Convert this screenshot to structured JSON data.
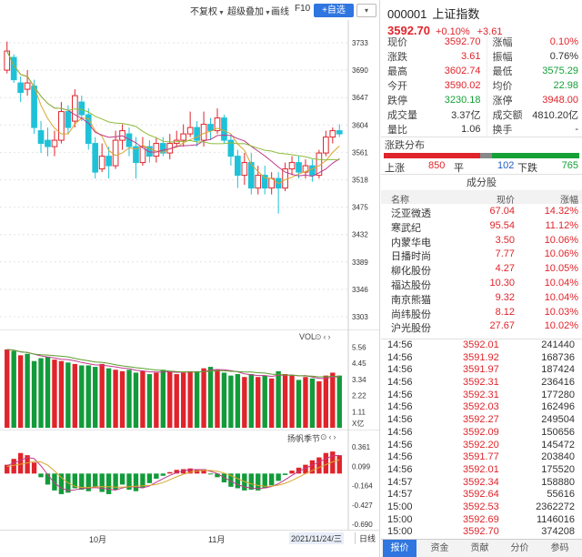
{
  "toolbar": {
    "adjust": "不复权",
    "overlay": "超级叠加",
    "drawline": "画线",
    "f10": "F10",
    "watch": "+自选"
  },
  "main_chart": {
    "price_ticks": [
      "3733",
      "3690",
      "3647",
      "3604",
      "3561",
      "3518",
      "3475",
      "3432",
      "3389",
      "3346",
      "3303"
    ],
    "ylim": [
      3303,
      3733
    ],
    "candles": [
      {
        "o": 3690,
        "c": 3720,
        "h": 3735,
        "l": 3685
      },
      {
        "o": 3710,
        "c": 3675,
        "h": 3715,
        "l": 3670
      },
      {
        "o": 3670,
        "c": 3655,
        "h": 3680,
        "l": 3640
      },
      {
        "o": 3660,
        "c": 3670,
        "h": 3690,
        "l": 3650
      },
      {
        "o": 3665,
        "c": 3600,
        "h": 3675,
        "l": 3590
      },
      {
        "o": 3595,
        "c": 3575,
        "h": 3610,
        "l": 3560
      },
      {
        "o": 3580,
        "c": 3570,
        "h": 3600,
        "l": 3555
      },
      {
        "o": 3570,
        "c": 3580,
        "h": 3595,
        "l": 3555
      },
      {
        "o": 3580,
        "c": 3625,
        "h": 3640,
        "l": 3575
      },
      {
        "o": 3625,
        "c": 3600,
        "h": 3635,
        "l": 3590
      },
      {
        "o": 3610,
        "c": 3650,
        "h": 3660,
        "l": 3600
      },
      {
        "o": 3640,
        "c": 3620,
        "h": 3650,
        "l": 3610
      },
      {
        "o": 3620,
        "c": 3575,
        "h": 3630,
        "l": 3565
      },
      {
        "o": 3575,
        "c": 3530,
        "h": 3585,
        "l": 3520
      },
      {
        "o": 3535,
        "c": 3555,
        "h": 3575,
        "l": 3530
      },
      {
        "o": 3555,
        "c": 3540,
        "h": 3570,
        "l": 3520
      },
      {
        "o": 3540,
        "c": 3580,
        "h": 3595,
        "l": 3535
      },
      {
        "o": 3580,
        "c": 3595,
        "h": 3605,
        "l": 3565
      },
      {
        "o": 3590,
        "c": 3570,
        "h": 3600,
        "l": 3555
      },
      {
        "o": 3570,
        "c": 3545,
        "h": 3585,
        "l": 3520
      },
      {
        "o": 3545,
        "c": 3570,
        "h": 3585,
        "l": 3540
      },
      {
        "o": 3570,
        "c": 3555,
        "h": 3580,
        "l": 3545
      },
      {
        "o": 3555,
        "c": 3575,
        "h": 3585,
        "l": 3545
      },
      {
        "o": 3575,
        "c": 3560,
        "h": 3585,
        "l": 3555
      },
      {
        "o": 3560,
        "c": 3575,
        "h": 3590,
        "l": 3550
      },
      {
        "o": 3575,
        "c": 3580,
        "h": 3595,
        "l": 3570
      },
      {
        "o": 3580,
        "c": 3590,
        "h": 3605,
        "l": 3570
      },
      {
        "o": 3590,
        "c": 3600,
        "h": 3625,
        "l": 3585
      },
      {
        "o": 3600,
        "c": 3580,
        "h": 3610,
        "l": 3570
      },
      {
        "o": 3580,
        "c": 3605,
        "h": 3625,
        "l": 3570
      },
      {
        "o": 3605,
        "c": 3595,
        "h": 3615,
        "l": 3580
      },
      {
        "o": 3595,
        "c": 3615,
        "h": 3630,
        "l": 3590
      },
      {
        "o": 3615,
        "c": 3580,
        "h": 3620,
        "l": 3575
      },
      {
        "o": 3580,
        "c": 3555,
        "h": 3590,
        "l": 3540
      },
      {
        "o": 3555,
        "c": 3525,
        "h": 3565,
        "l": 3505
      },
      {
        "o": 3525,
        "c": 3545,
        "h": 3560,
        "l": 3510
      },
      {
        "o": 3545,
        "c": 3505,
        "h": 3560,
        "l": 3495
      },
      {
        "o": 3505,
        "c": 3525,
        "h": 3540,
        "l": 3495
      },
      {
        "o": 3525,
        "c": 3505,
        "h": 3540,
        "l": 3495
      },
      {
        "o": 3505,
        "c": 3520,
        "h": 3530,
        "l": 3495
      },
      {
        "o": 3520,
        "c": 3505,
        "h": 3530,
        "l": 3465
      },
      {
        "o": 3505,
        "c": 3535,
        "h": 3545,
        "l": 3500
      },
      {
        "o": 3535,
        "c": 3545,
        "h": 3555,
        "l": 3525
      },
      {
        "o": 3545,
        "c": 3530,
        "h": 3555,
        "l": 3520
      },
      {
        "o": 3530,
        "c": 3540,
        "h": 3550,
        "l": 3520
      },
      {
        "o": 3540,
        "c": 3525,
        "h": 3550,
        "l": 3515
      },
      {
        "o": 3525,
        "c": 3560,
        "h": 3565,
        "l": 3520
      },
      {
        "o": 3560,
        "c": 3585,
        "h": 3595,
        "l": 3555
      },
      {
        "o": 3585,
        "c": 3595,
        "h": 3600,
        "l": 3575
      },
      {
        "o": 3595,
        "c": 3590,
        "h": 3605,
        "l": 3585
      }
    ]
  },
  "vol_chart": {
    "title": "VOL",
    "ticks": [
      "5.56",
      "4.45",
      "3.34",
      "2.22",
      "1.11"
    ],
    "unit": "X亿",
    "ylim": [
      0,
      5.9
    ],
    "values": [
      5.4,
      5.3,
      5.0,
      5.1,
      4.6,
      4.8,
      4.9,
      4.7,
      4.6,
      4.5,
      4.4,
      4.3,
      4.3,
      4.2,
      4.4,
      4.1,
      4.0,
      3.9,
      4.0,
      3.8,
      3.9,
      3.7,
      3.8,
      4.0,
      3.9,
      3.7,
      3.8,
      3.9,
      3.9,
      4.1,
      4.2,
      4.0,
      3.8,
      3.6,
      3.7,
      3.5,
      3.7,
      3.5,
      3.6,
      3.4,
      3.9,
      3.7,
      3.6,
      3.3,
      3.5,
      3.4,
      3.2,
      3.6,
      3.8,
      3.6
    ],
    "up": [
      1,
      0,
      1,
      0,
      0,
      0,
      0,
      1,
      1,
      0,
      1,
      0,
      0,
      0,
      1,
      0,
      1,
      1,
      0,
      0,
      1,
      0,
      1,
      0,
      1,
      1,
      1,
      1,
      0,
      1,
      0,
      1,
      0,
      0,
      0,
      1,
      0,
      1,
      0,
      1,
      0,
      1,
      1,
      0,
      1,
      0,
      1,
      1,
      1,
      0
    ]
  },
  "macd_chart": {
    "title": "扬帆季节",
    "ticks": [
      "0.361",
      "0.099",
      "-0.164",
      "-0.427",
      "-0.690"
    ],
    "ylim": [
      -0.69,
      0.45
    ],
    "values": [
      0.12,
      0.2,
      0.28,
      0.25,
      0.15,
      -0.05,
      -0.15,
      -0.23,
      -0.28,
      -0.26,
      -0.2,
      -0.22,
      -0.24,
      -0.18,
      -0.25,
      -0.28,
      -0.22,
      -0.15,
      -0.22,
      -0.24,
      -0.19,
      -0.13,
      -0.07,
      -0.03,
      0.02,
      0.05,
      0.06,
      0.07,
      0.05,
      0.06,
      -0.01,
      -0.05,
      -0.12,
      -0.18,
      -0.2,
      -0.23,
      -0.22,
      -0.23,
      -0.2,
      -0.16,
      -0.1,
      -0.02,
      0.04,
      0.08,
      0.12,
      0.18,
      0.22,
      0.28,
      0.3,
      0.25
    ]
  },
  "time_axis": {
    "labels": [
      "10月",
      "11月"
    ],
    "date": "2021/11/24/三",
    "day": "日线"
  },
  "quote": {
    "code": "000001",
    "name": "上证指数",
    "price": "3592.70",
    "pct": "+0.10%",
    "change": "+3.61",
    "rows": [
      {
        "k": "现价",
        "v": "3592.70",
        "vc": "red",
        "k2": "涨幅",
        "v2": "0.10%",
        "v2c": "red"
      },
      {
        "k": "涨跌",
        "v": "3.61",
        "vc": "red",
        "k2": "振幅",
        "v2": "0.76%",
        "v2c": "blk"
      },
      {
        "k": "最高",
        "v": "3602.74",
        "vc": "red",
        "k2": "最低",
        "v2": "3575.29",
        "v2c": "green"
      },
      {
        "k": "今开",
        "v": "3590.02",
        "vc": "red",
        "k2": "均价",
        "v2": "22.98",
        "v2c": "green"
      },
      {
        "k": "跌停",
        "v": "3230.18",
        "vc": "green",
        "k2": "涨停",
        "v2": "3948.00",
        "v2c": "red"
      },
      {
        "k": "成交量",
        "v": "3.37亿",
        "vc": "blk",
        "k2": "成交额",
        "v2": "4810.20亿",
        "v2c": "blk"
      },
      {
        "k": "量比",
        "v": "1.06",
        "vc": "blk",
        "k2": "换手",
        "v2": "-",
        "v2c": "blk"
      }
    ]
  },
  "distribution": {
    "title": "涨跌分布",
    "up_label": "上涨",
    "up": "850",
    "flat_label": "平",
    "flat": "102",
    "down_label": "下跌",
    "down": "765",
    "up_count": 850,
    "flat_count": 102,
    "down_count": 765
  },
  "components": {
    "title": "成分股",
    "headers": [
      "名称",
      "现价",
      "涨幅"
    ],
    "rows": [
      {
        "name": "泛亚微透",
        "price": "67.04",
        "pct": "14.32%"
      },
      {
        "name": "寒武纪",
        "price": "95.54",
        "pct": "11.12%"
      },
      {
        "name": "内蒙华电",
        "price": "3.50",
        "pct": "10.06%"
      },
      {
        "name": "日播时尚",
        "price": "7.77",
        "pct": "10.06%"
      },
      {
        "name": "柳化股份",
        "price": "4.27",
        "pct": "10.05%"
      },
      {
        "name": "福达股份",
        "price": "10.30",
        "pct": "10.04%"
      },
      {
        "name": "南京熊猫",
        "price": "9.32",
        "pct": "10.04%"
      },
      {
        "name": "尚纬股份",
        "price": "8.12",
        "pct": "10.03%"
      },
      {
        "name": "沪光股份",
        "price": "27.67",
        "pct": "10.02%"
      }
    ]
  },
  "trades": [
    {
      "t": "14:56",
      "p": "3592.01",
      "v": "241440",
      "c": "red"
    },
    {
      "t": "14:56",
      "p": "3591.92",
      "v": "168736",
      "c": "red"
    },
    {
      "t": "14:56",
      "p": "3591.97",
      "v": "187424",
      "c": "red"
    },
    {
      "t": "14:56",
      "p": "3592.31",
      "v": "236416",
      "c": "red"
    },
    {
      "t": "14:56",
      "p": "3592.31",
      "v": "177280",
      "c": "red"
    },
    {
      "t": "14:56",
      "p": "3592.03",
      "v": "162496",
      "c": "red"
    },
    {
      "t": "14:56",
      "p": "3592.27",
      "v": "249504",
      "c": "red"
    },
    {
      "t": "14:56",
      "p": "3592.09",
      "v": "150656",
      "c": "red"
    },
    {
      "t": "14:56",
      "p": "3592.20",
      "v": "145472",
      "c": "red"
    },
    {
      "t": "14:56",
      "p": "3591.77",
      "v": "203840",
      "c": "red"
    },
    {
      "t": "14:56",
      "p": "3592.01",
      "v": "175520",
      "c": "red"
    },
    {
      "t": "14:57",
      "p": "3592.34",
      "v": "158880",
      "c": "red"
    },
    {
      "t": "14:57",
      "p": "3592.64",
      "v": "55616",
      "c": "red"
    },
    {
      "t": "15:00",
      "p": "3592.53",
      "v": "2362272",
      "c": "red"
    },
    {
      "t": "15:00",
      "p": "3592.69",
      "v": "1146016",
      "c": "red"
    },
    {
      "t": "15:00",
      "p": "3592.70",
      "v": "374208",
      "c": "red"
    }
  ],
  "tabs": [
    {
      "label": "报价",
      "active": true
    },
    {
      "label": "资金",
      "active": false
    },
    {
      "label": "贡献",
      "active": false
    },
    {
      "label": "分价",
      "active": false
    },
    {
      "label": "参码",
      "active": false
    }
  ],
  "colors": {
    "up": "#e0242b",
    "down": "#16a038",
    "flat": "#3366cc",
    "accent": "#2f76e0"
  }
}
